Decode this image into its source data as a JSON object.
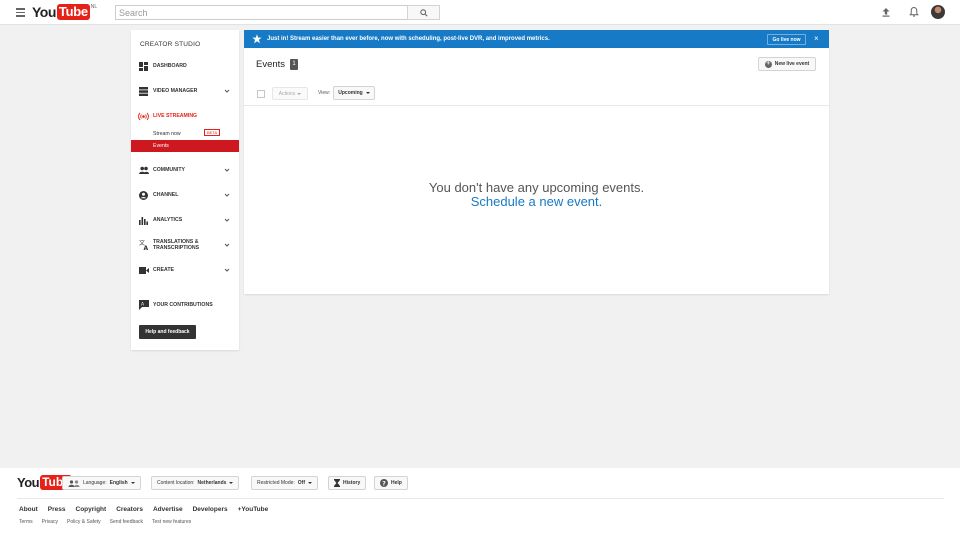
{
  "header": {
    "logo_you": "You",
    "logo_tube": "Tube",
    "logo_country": "NL",
    "search_placeholder": "Search",
    "icons": [
      "menu-icon",
      "search-icon",
      "upload-icon",
      "bell-icon",
      "avatar"
    ]
  },
  "sidebar": {
    "title": "CREATOR STUDIO",
    "items": [
      {
        "label": "DASHBOARD",
        "icon": "dashboard-icon"
      },
      {
        "label": "VIDEO MANAGER",
        "icon": "video-manager-icon"
      },
      {
        "label": "LIVE STREAMING",
        "icon": "live-streaming-icon"
      },
      {
        "label": "COMMUNITY",
        "icon": "community-icon"
      },
      {
        "label": "CHANNEL",
        "icon": "channel-icon"
      },
      {
        "label": "ANALYTICS",
        "icon": "analytics-icon"
      },
      {
        "label": "TRANSLATIONS &",
        "label2": "TRANSCRIPTIONS",
        "icon": "translate-icon"
      },
      {
        "label": "CREATE",
        "icon": "create-icon"
      },
      {
        "label": "YOUR CONTRIBUTIONS",
        "icon": "contributions-icon"
      }
    ],
    "live_sub": {
      "stream_now": "Stream now",
      "beta": "BETA",
      "events": "Events"
    },
    "help_feedback": "Help and feedback"
  },
  "banner": {
    "message": "Just in! Stream easier than ever before, now with scheduling, post-live DVR, and improved metrics.",
    "go_live": "Go live now",
    "close": "×"
  },
  "main": {
    "title": "Events",
    "count": "1",
    "new_live_event": "New live event",
    "actions": "Actions",
    "view_label": "View:",
    "view_value": "Upcoming",
    "empty_text": "You don't have any upcoming events.",
    "empty_link": "Schedule a new event."
  },
  "footer": {
    "logo_you": "You",
    "logo_tube": "Tube",
    "language_label": "Language:",
    "language_value": "English",
    "location_label": "Content location:",
    "location_value": "Netherlands",
    "restricted_label": "Restricted Mode:",
    "restricted_value": "Off",
    "history": "History",
    "help": "Help",
    "links_primary": [
      "About",
      "Press",
      "Copyright",
      "Creators",
      "Advertise",
      "Developers",
      "+YouTube"
    ],
    "links_secondary": [
      "Terms",
      "Privacy",
      "Policy & Safety",
      "Send feedback",
      "Test new features"
    ]
  },
  "colors": {
    "brand_red": "#e62117",
    "active_red": "#cc181e",
    "banner_blue": "#167ac6",
    "page_bg": "#f1f1f1"
  }
}
